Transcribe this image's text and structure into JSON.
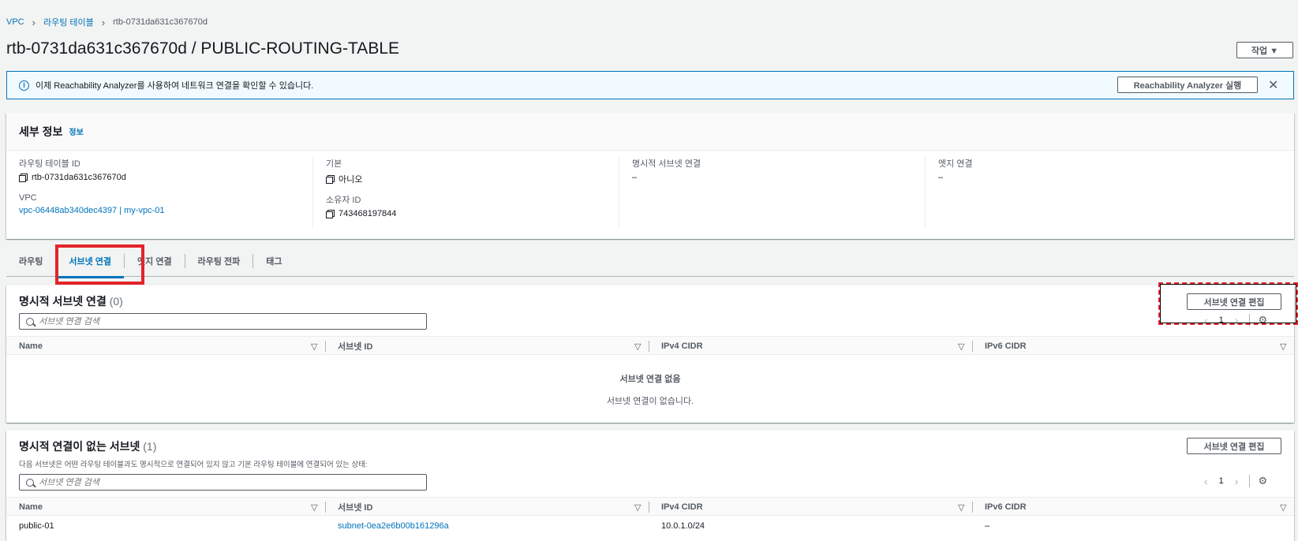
{
  "breadcrumb": {
    "root": "VPC",
    "parent": "라우팅 테이블",
    "current": "rtb-0731da631c367670d"
  },
  "page": {
    "title": "rtb-0731da631c367670d / PUBLIC-ROUTING-TABLE",
    "actions_label": "작업 ▼"
  },
  "alert": {
    "text": "이제 Reachability Analyzer를 사용하여 네트워크 연결을 확인할 수 있습니다.",
    "button": "Reachability Analyzer 실행",
    "close": "✕",
    "info": "i"
  },
  "details": {
    "title": "세부 정보",
    "info_link": "정보",
    "route_table_id_label": "라우팅 테이블 ID",
    "route_table_id": "rtb-0731da631c367670d",
    "vpc_label": "VPC",
    "vpc_value": "vpc-06448ab340dec4397 | my-vpc-01",
    "main_label": "기본",
    "main_value": "아니오",
    "owner_label": "소유자 ID",
    "owner_value": "743468197844",
    "explicit_label": "명시적 서브넷 연결",
    "explicit_value": "–",
    "edge_label": "엣지 연결",
    "edge_value": "–"
  },
  "tabs": [
    "라우팅",
    "서브넷 연결",
    "엣지 연결",
    "라우팅 전파",
    "태그"
  ],
  "explicit_panel": {
    "title": "명시적 서브넷 연결",
    "count": "(0)",
    "edit_button": "서브넷 연결 편집",
    "search_placeholder": "서브넷 연결 검색",
    "page": "1",
    "columns": [
      "Name",
      "서브넷 ID",
      "IPv4 CIDR",
      "IPv6 CIDR"
    ],
    "empty_title": "서브넷 연결 없음",
    "empty_text": "서브넷 연결이 없습니다."
  },
  "implicit_panel": {
    "title": "명시적 연결이 없는 서브넷",
    "count": "(1)",
    "subtitle": "다음 서브넷은 어떤 라우팅 테이블과도 명시적으로 연결되어 있지 않고 기본 라우팅 테이블에 연결되어 있는 상태:",
    "edit_button": "서브넷 연결 편집",
    "search_placeholder": "서브넷 연결 검색",
    "page": "1",
    "columns": [
      "Name",
      "서브넷 ID",
      "IPv4 CIDR",
      "IPv6 CIDR"
    ],
    "rows": [
      {
        "name": "public-01",
        "subnet_id": "subnet-0ea2e6b00b161296a",
        "ipv4": "10.0.1.0/24",
        "ipv6": "–"
      }
    ]
  },
  "icons": {
    "gear": "⚙",
    "prev": "‹",
    "next": "›",
    "sort": "▽",
    "chevron": "›"
  },
  "colors": {
    "link": "#0073bb",
    "highlight": "#e3242b",
    "alert_bg": "#f1faff"
  }
}
